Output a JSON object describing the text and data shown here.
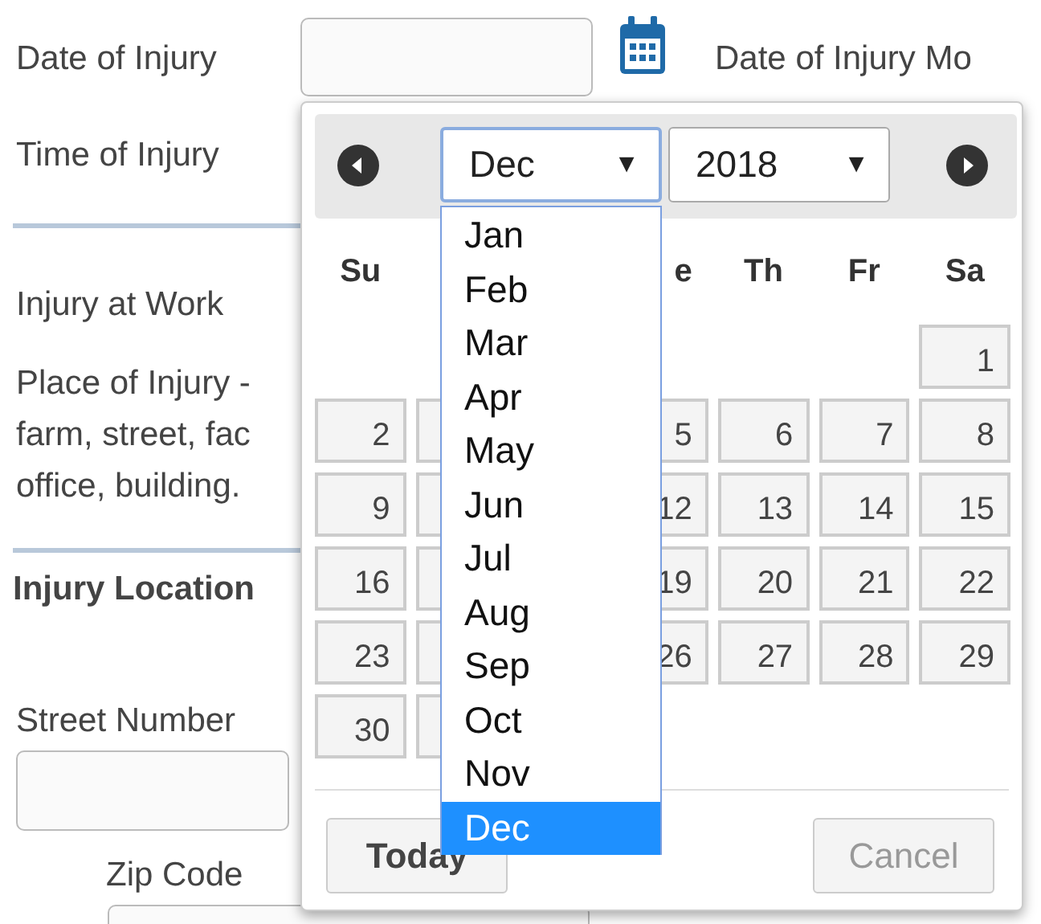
{
  "form": {
    "date_label": "Date of Injury",
    "date_mode_label": "Date of Injury Mo",
    "time_label": "Time of Injury",
    "work_label": "Injury at Work",
    "place_lines": [
      "Place of Injury -",
      "farm, street, fac",
      "office, building."
    ],
    "location_heading": "Injury Location",
    "street_label": "Street Number",
    "zip_label": "Zip Code"
  },
  "datepicker": {
    "month": "Dec",
    "month_caret": "▼",
    "year": "2018",
    "year_caret": "▼",
    "weekdays": [
      {
        "kind": "text",
        "text": "Su"
      },
      {
        "kind": "covered"
      },
      {
        "kind": "covered"
      },
      {
        "kind": "partial",
        "text": "e"
      },
      {
        "kind": "text",
        "text": "Th"
      },
      {
        "kind": "text",
        "text": "Fr"
      },
      {
        "kind": "text",
        "text": "Sa"
      }
    ],
    "weeks": [
      [
        {
          "kind": "none"
        },
        {
          "kind": "none"
        },
        {
          "kind": "none"
        },
        {
          "kind": "none"
        },
        {
          "kind": "none"
        },
        {
          "kind": "none"
        },
        {
          "kind": "day",
          "text": "1"
        }
      ],
      [
        {
          "kind": "day",
          "text": "2"
        },
        {
          "kind": "box"
        },
        {
          "kind": "covered"
        },
        {
          "kind": "day",
          "text": "5"
        },
        {
          "kind": "day",
          "text": "6"
        },
        {
          "kind": "day",
          "text": "7"
        },
        {
          "kind": "day",
          "text": "8"
        }
      ],
      [
        {
          "kind": "day",
          "text": "9"
        },
        {
          "kind": "box"
        },
        {
          "kind": "covered"
        },
        {
          "kind": "day",
          "text": "12"
        },
        {
          "kind": "day",
          "text": "13"
        },
        {
          "kind": "day",
          "text": "14"
        },
        {
          "kind": "day",
          "text": "15"
        }
      ],
      [
        {
          "kind": "day",
          "text": "16"
        },
        {
          "kind": "box"
        },
        {
          "kind": "covered"
        },
        {
          "kind": "day",
          "text": "19"
        },
        {
          "kind": "day",
          "text": "20"
        },
        {
          "kind": "day",
          "text": "21"
        },
        {
          "kind": "day",
          "text": "22"
        }
      ],
      [
        {
          "kind": "day",
          "text": "23"
        },
        {
          "kind": "box"
        },
        {
          "kind": "covered"
        },
        {
          "kind": "day",
          "text": "26"
        },
        {
          "kind": "day",
          "text": "27"
        },
        {
          "kind": "day",
          "text": "28"
        },
        {
          "kind": "day",
          "text": "29"
        }
      ],
      [
        {
          "kind": "day",
          "text": "30"
        },
        {
          "kind": "box"
        },
        {
          "kind": "none"
        },
        {
          "kind": "none"
        },
        {
          "kind": "none"
        },
        {
          "kind": "none"
        },
        {
          "kind": "none"
        }
      ]
    ],
    "today_button": "Today",
    "cancel_button": "Cancel",
    "cancel_disabled": true,
    "month_options": [
      {
        "label": "Jan",
        "selected": false
      },
      {
        "label": "Feb",
        "selected": false
      },
      {
        "label": "Mar",
        "selected": false
      },
      {
        "label": "Apr",
        "selected": false
      },
      {
        "label": "May",
        "selected": false
      },
      {
        "label": "Jun",
        "selected": false
      },
      {
        "label": "Jul",
        "selected": false
      },
      {
        "label": "Aug",
        "selected": false
      },
      {
        "label": "Sep",
        "selected": false
      },
      {
        "label": "Oct",
        "selected": false
      },
      {
        "label": "Nov",
        "selected": false
      },
      {
        "label": "Dec",
        "selected": true
      }
    ]
  }
}
